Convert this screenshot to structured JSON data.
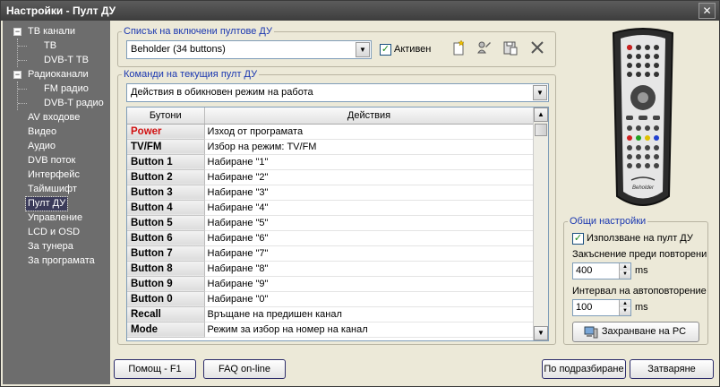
{
  "window": {
    "title": "Настройки - Пулт ДУ",
    "close_glyph": "✕"
  },
  "tree": {
    "items": [
      {
        "label": "ТВ канали",
        "expander": "−"
      },
      {
        "label": "ТВ"
      },
      {
        "label": "DVB-T ТВ"
      },
      {
        "label": "Радиоканали",
        "expander": "−"
      },
      {
        "label": "FM радио"
      },
      {
        "label": "DVB-T радио"
      },
      {
        "label": "AV входове"
      },
      {
        "label": "Видео"
      },
      {
        "label": "Аудио"
      },
      {
        "label": "DVB поток"
      },
      {
        "label": "Интерфейс"
      },
      {
        "label": "Таймшифт"
      },
      {
        "label": "Пулт ДУ"
      },
      {
        "label": "Управление"
      },
      {
        "label": "LCD и OSD"
      },
      {
        "label": "За тунера"
      },
      {
        "label": "За програмата"
      }
    ]
  },
  "remote_list": {
    "legend": "Списък на включени пултове ДУ",
    "selected": "Beholder (34 buttons)",
    "active_label": "Активен",
    "active_check": "✓"
  },
  "commands": {
    "legend": "Команди на текущия пулт ДУ",
    "mode_selected": "Действия в обикновен режим на работа",
    "col_buttons": "Бутони",
    "col_actions": "Действия",
    "rows": [
      {
        "button": "Power",
        "action": "Изход от програмата"
      },
      {
        "button": "TV/FM",
        "action": "Избор на режим: TV/FM"
      },
      {
        "button": "Button 1",
        "action": "Набиране \"1\""
      },
      {
        "button": "Button 2",
        "action": "Набиране \"2\""
      },
      {
        "button": "Button 3",
        "action": "Набиране \"3\""
      },
      {
        "button": "Button 4",
        "action": "Набиране \"4\""
      },
      {
        "button": "Button 5",
        "action": "Набиране \"5\""
      },
      {
        "button": "Button 6",
        "action": "Набиране \"6\""
      },
      {
        "button": "Button 7",
        "action": "Набиране \"7\""
      },
      {
        "button": "Button 8",
        "action": "Набиране \"8\""
      },
      {
        "button": "Button 9",
        "action": "Набиране \"9\""
      },
      {
        "button": "Button 0",
        "action": "Набиране \"0\""
      },
      {
        "button": "Recall",
        "action": "Връщане на предишен канал"
      },
      {
        "button": "Mode",
        "action": "Режим за избор на номер на канал"
      }
    ]
  },
  "remote_brand": "Beholder",
  "general": {
    "legend": "Общи настройки",
    "use_remote_label": "Използване на пулт ДУ",
    "use_remote_check": "✓",
    "delay_label": "Закъснение преди повторени",
    "delay_value": "400",
    "delay_unit": "ms",
    "interval_label": "Интервал на автоповторение",
    "interval_value": "100",
    "interval_unit": "ms",
    "save_pc_label": "Захранване на PC"
  },
  "footer": {
    "help": "Помощ - F1",
    "faq": "FAQ on-line",
    "defaults": "По подразбиране",
    "close": "Затваряне"
  },
  "colors": {
    "accent_legend": "#1a37b0",
    "power_red": "#d01010",
    "sidebar_bg": "#6d6d6d"
  }
}
